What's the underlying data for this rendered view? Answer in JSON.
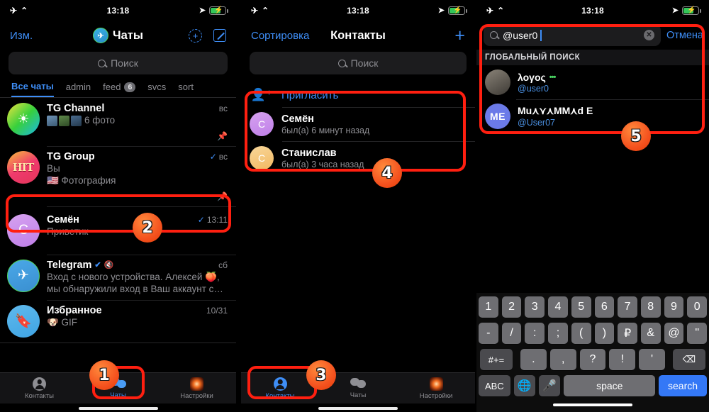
{
  "status_bar": {
    "airplane_icon": "airplane-mode-icon",
    "wifi_icon": "wifi-icon",
    "time": "13:18",
    "location_icon": "location-arrow-icon",
    "battery_icon": "battery-charging-icon"
  },
  "colors": {
    "accent_blue": "#3e8ef7",
    "annotation_red": "#ff1f10",
    "annotation_orange": "#f4511e",
    "green_online": "#4cd964",
    "muted_gray": "#8e8e93"
  },
  "panel_chats": {
    "nav": {
      "left_label": "Изм.",
      "title": "Чаты",
      "logo_icon": "telegram-logo-icon",
      "add_icon": "add-circle-dashed-icon",
      "compose_icon": "compose-pencil-icon"
    },
    "search_placeholder": "Поиск",
    "search_icon": "search-icon",
    "tabs": [
      {
        "label": "Все чаты",
        "badge": ""
      },
      {
        "label": "admin",
        "badge": ""
      },
      {
        "label": "feed",
        "badge": "6"
      },
      {
        "label": "svcs",
        "badge": ""
      },
      {
        "label": "sort",
        "badge": ""
      }
    ],
    "chats": [
      {
        "avatar_text": "",
        "avatar_kind": "sun",
        "name": "TG Channel",
        "message": "6 фото",
        "time": "вс",
        "pinned_icon": "pin-icon",
        "has_thumbs": true,
        "read_check": false
      },
      {
        "avatar_text": "HIT",
        "avatar_kind": "hit",
        "name": "TG Group",
        "message_line1": "Вы",
        "message": "🇺🇸 Фотография",
        "time": "вс",
        "pinned_icon": "pin-icon",
        "read_check": true
      },
      {
        "avatar_text": "C",
        "avatar_kind": "purple",
        "name": "Семён",
        "message": "Приветик",
        "time": "13:11",
        "read_check": true,
        "highlighted": true
      },
      {
        "avatar_text": "",
        "avatar_kind": "tg",
        "name": "Telegram",
        "verified_icon": "verified-badge-icon",
        "muted_icon": "muted-bell-icon",
        "message": "Вход с нового устройства. Алексей 🍑, мы обнаружили вход в Ваш аккаунт с…",
        "time": "сб",
        "read_check": false
      },
      {
        "avatar_text": "",
        "avatar_kind": "saved",
        "name": "Избранное",
        "message": "🐶 GIF",
        "time": "10/31",
        "read_check": false
      }
    ],
    "tabbar": [
      {
        "label": "Контакты",
        "icon": "contacts-person-icon",
        "active": false
      },
      {
        "label": "Чаты",
        "icon": "chats-bubbles-icon",
        "active": true
      },
      {
        "label": "Настройки",
        "icon": "settings-icon",
        "active": false
      }
    ]
  },
  "panel_contacts": {
    "nav": {
      "left_label": "Сортировка",
      "title": "Контакты",
      "add_icon": "plus-icon"
    },
    "search_placeholder": "Поиск",
    "search_icon": "search-icon",
    "invite": {
      "label": "Пригласить",
      "icon": "add-person-icon"
    },
    "contacts": [
      {
        "avatar_text": "C",
        "avatar_kind": "purple",
        "name": "Семён",
        "status": "был(а) 6 минут назад"
      },
      {
        "avatar_text": "C",
        "avatar_kind": "orange",
        "name": "Станислав",
        "status": "был(а) 3 часа назад"
      }
    ],
    "tabbar": [
      {
        "label": "Контакты",
        "icon": "contacts-person-icon",
        "active": true
      },
      {
        "label": "Чаты",
        "icon": "chats-bubbles-icon",
        "active": false
      },
      {
        "label": "Настройки",
        "icon": "settings-icon",
        "active": false
      }
    ]
  },
  "panel_search": {
    "search_value": "@user0",
    "search_icon": "search-icon",
    "clear_icon": "clear-circle-icon",
    "cancel_label": "Отмена",
    "section_header": "ГЛОБАЛЬНЫЙ ПОИСК",
    "results": [
      {
        "avatar_text": "",
        "avatar_kind": "photo",
        "name": "λογος",
        "online_dots": "•••",
        "username": "@user0"
      },
      {
        "avatar_text": "ME",
        "avatar_kind": "me",
        "name": "Mu⋏⋎⋏MM⋏d E",
        "online_dots": "",
        "username": "@User07"
      }
    ],
    "keyboard": {
      "row1": [
        "1",
        "2",
        "3",
        "4",
        "5",
        "6",
        "7",
        "8",
        "9",
        "0"
      ],
      "row2": [
        "-",
        "/",
        ":",
        ";",
        "(",
        ")",
        "₽",
        "&",
        "@",
        "\""
      ],
      "row3_fn": "#+=",
      "row3": [
        ".",
        ",",
        "?",
        "!",
        "'"
      ],
      "row3_backspace": "backspace-icon",
      "row4_abc": "ABC",
      "row4_globe": "globe-icon",
      "row4_mic": "microphone-icon",
      "row4_space": "space",
      "row4_action": "search"
    }
  },
  "annotations": {
    "steps": [
      {
        "number": "1"
      },
      {
        "number": "2"
      },
      {
        "number": "3"
      },
      {
        "number": "4"
      },
      {
        "number": "5"
      }
    ]
  }
}
